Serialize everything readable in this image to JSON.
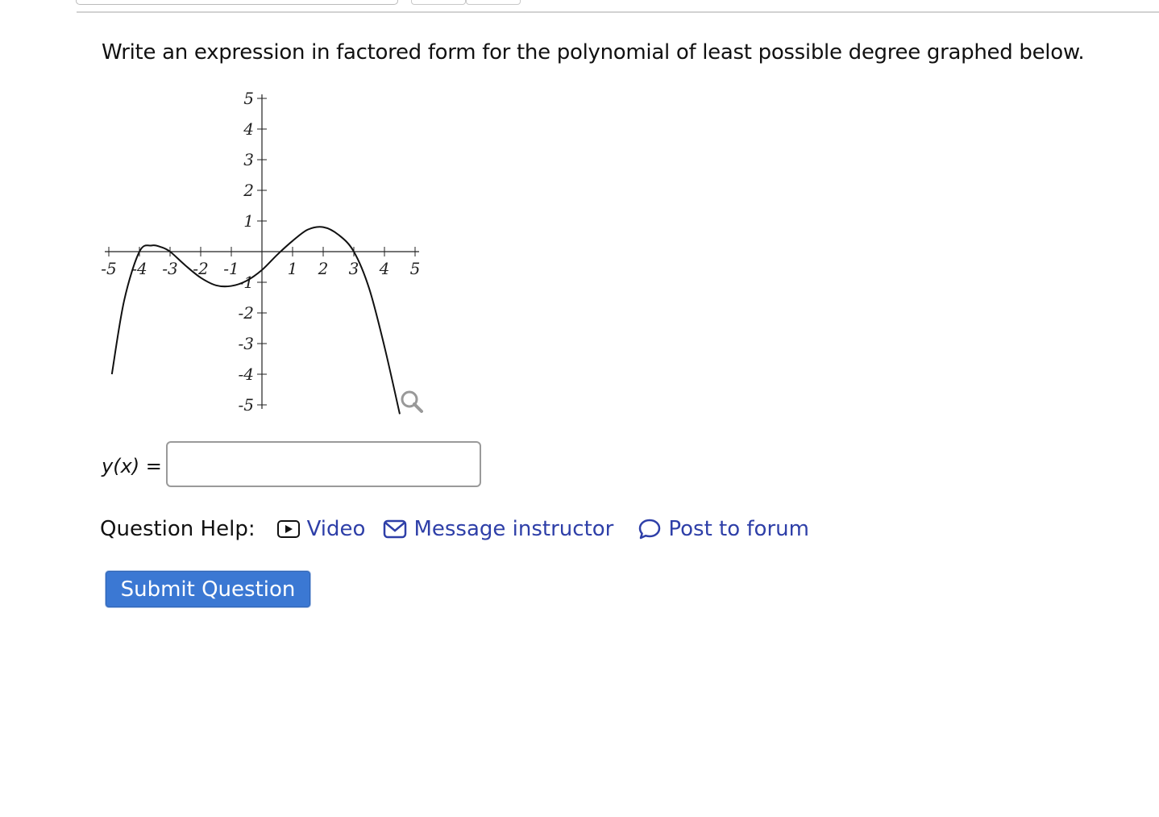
{
  "question": {
    "text": "Write an expression in factored form for the polynomial of least possible degree graphed below."
  },
  "graph": {
    "x_ticks": [
      "-5",
      "-4",
      "-3",
      "-2",
      "-1",
      "1",
      "2",
      "3",
      "4",
      "5"
    ],
    "y_ticks": [
      "5",
      "4",
      "3",
      "2",
      "1",
      "-1",
      "-2",
      "-3",
      "-4",
      "-5"
    ],
    "zoom_icon": "magnifier-icon"
  },
  "chart_data": {
    "type": "line",
    "xlim": [
      -5,
      5
    ],
    "ylim": [
      -5,
      5
    ],
    "x": [
      -4.9,
      -4.5,
      -4,
      -3.6,
      -3.3,
      -3,
      -2.5,
      -2,
      -1.5,
      -1,
      -0.5,
      0,
      0.5,
      1,
      1.5,
      2,
      2.5,
      3,
      3.5,
      4,
      4.5
    ],
    "y": [
      -4.0,
      -1.6,
      0,
      0.2,
      0.15,
      0,
      -0.45,
      -0.85,
      -1.1,
      -1.12,
      -0.95,
      -0.6,
      -0.1,
      0.35,
      0.72,
      0.8,
      0.55,
      0,
      -1.2,
      -3.1,
      -5.3
    ],
    "grid": false
  },
  "answer": {
    "label": "y(x)",
    "equals": "=",
    "value": ""
  },
  "help": {
    "label": "Question Help:",
    "video": "Video",
    "message": "Message instructor",
    "forum": "Post to forum"
  },
  "submit": {
    "label": "Submit Question"
  },
  "colors": {
    "link": "#2e3fa8",
    "button": "#3b78d3"
  }
}
